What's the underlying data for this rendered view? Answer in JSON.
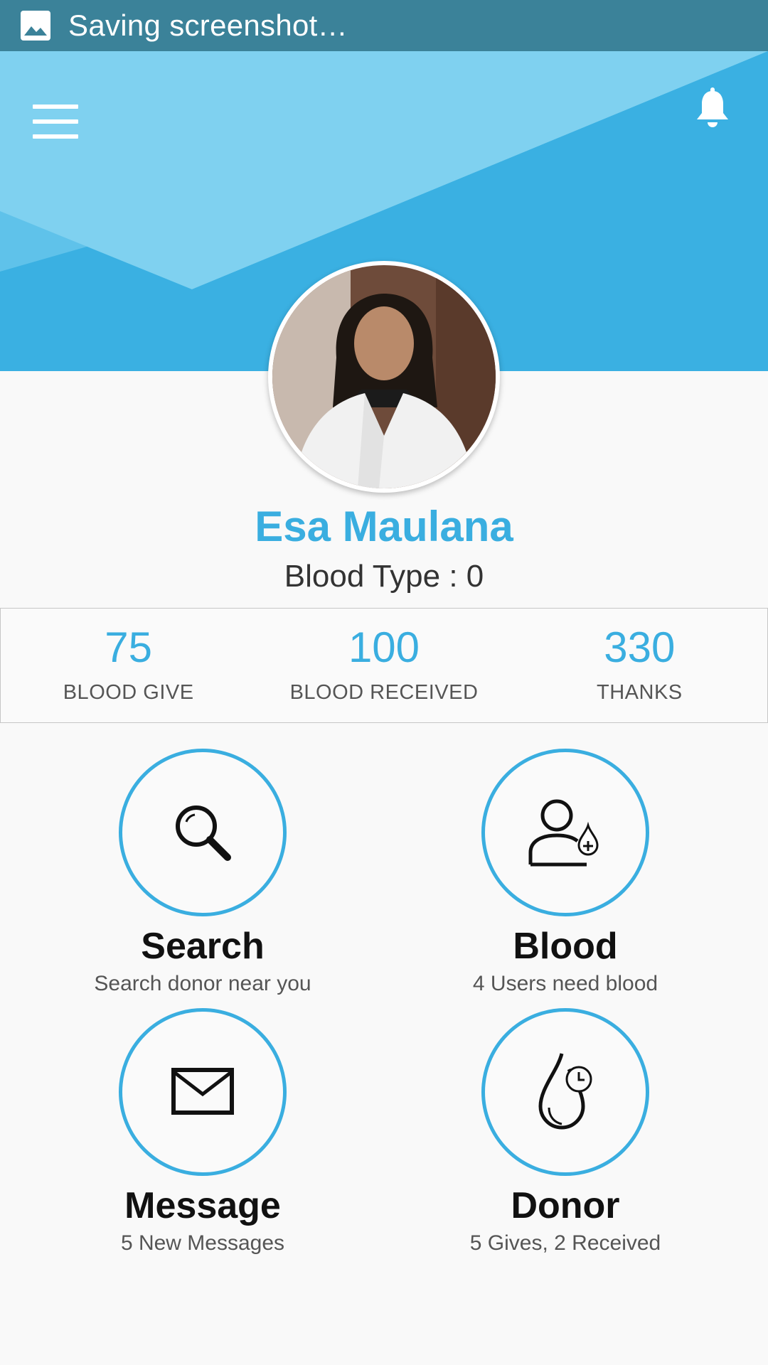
{
  "status_bar": {
    "text": "Saving screenshot…",
    "icon": "image-icon"
  },
  "header": {
    "menu_icon": "hamburger-menu-icon",
    "notification_icon": "bell-icon",
    "colors": {
      "light": "#7fd1f0",
      "dark": "#3ab0e2"
    }
  },
  "profile": {
    "name": "Esa Maulana",
    "blood_type": "Blood Type : 0"
  },
  "stats": [
    {
      "value": "75",
      "label": "BLOOD GIVE"
    },
    {
      "value": "100",
      "label": "BLOOD RECEIVED"
    },
    {
      "value": "330",
      "label": "THANKS"
    }
  ],
  "menu": [
    {
      "title": "Search",
      "subtitle": "Search donor near you",
      "icon": "magnifier-icon"
    },
    {
      "title": "Blood",
      "subtitle": "4 Users need blood",
      "icon": "user-blood-drop-icon"
    },
    {
      "title": "Message",
      "subtitle": "5 New Messages",
      "icon": "envelope-icon"
    },
    {
      "title": "Donor",
      "subtitle": "5 Gives, 2 Received",
      "icon": "drop-clock-icon"
    }
  ],
  "accent_color": "#3aaee0"
}
